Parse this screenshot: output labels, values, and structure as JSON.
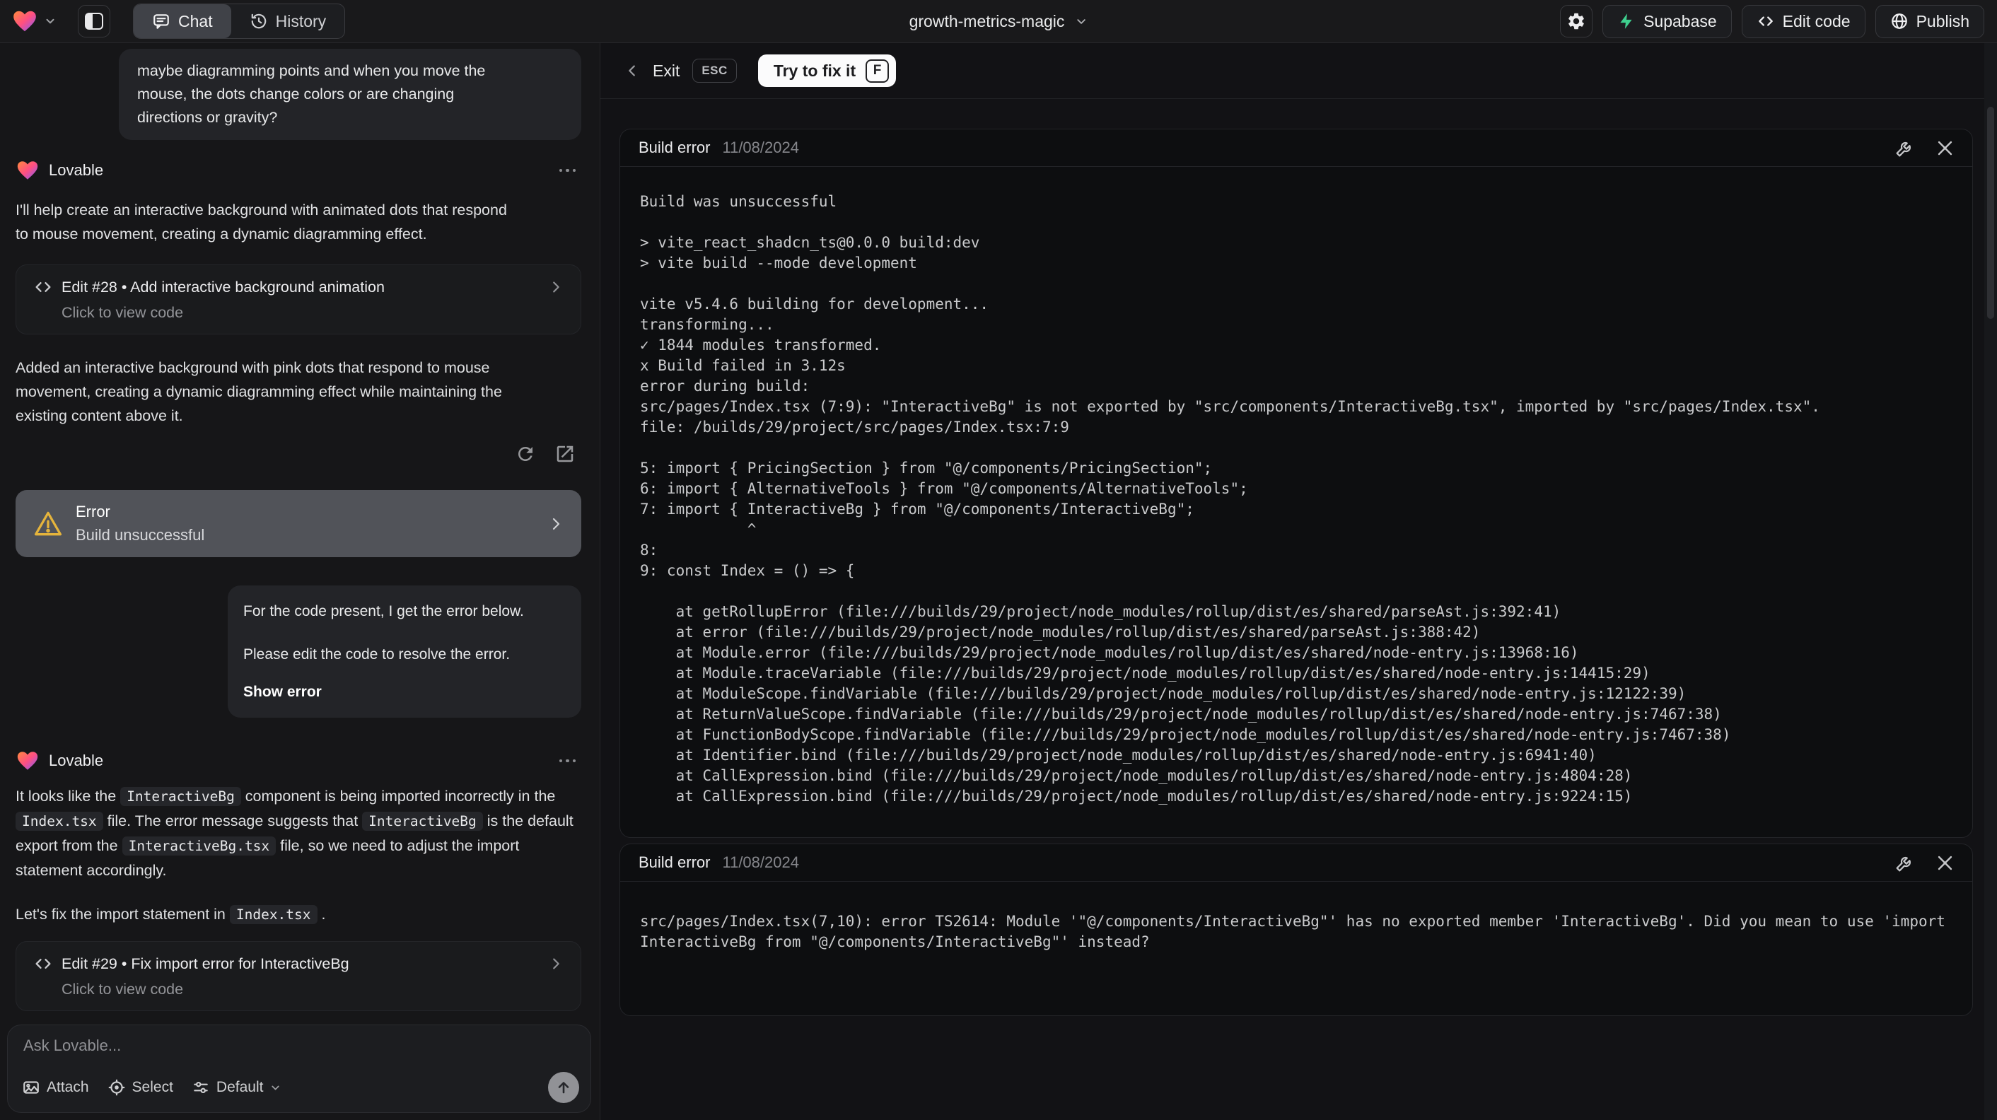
{
  "topbar": {
    "tabs": {
      "chat": "Chat",
      "history": "History"
    },
    "project": {
      "name": "growth-metrics-magic"
    },
    "actions": {
      "supabase": "Supabase",
      "edit_code": "Edit code",
      "publish": "Publish"
    }
  },
  "fix_header": {
    "exit": "Exit",
    "esc_key": "ESC",
    "fix_button": "Try to fix it",
    "fix_key": "F"
  },
  "chat": {
    "user_message_1": "maybe diagramming points and when you move the\nmouse, the dots change colors or are changing\ndirections or gravity?",
    "assistant_name": "Lovable",
    "assistant_1": {
      "p1": "I'll help create an interactive background with animated dots that respond\nto mouse movement, creating a dynamic diagramming effect.",
      "edit_card": {
        "title": "Edit #28 • Add interactive background animation",
        "subtitle": "Click to view code"
      },
      "p2": "Added an interactive background with pink dots that respond to mouse\nmovement, creating a dynamic diagramming effect while maintaining the\nexisting content above it."
    },
    "error_card": {
      "title": "Error",
      "subtitle": "Build unsuccessful"
    },
    "user_message_2": {
      "p1": "For the code present, I get the error below.",
      "p2": "Please edit the code to resolve the error.",
      "link": "Show error"
    },
    "assistant_2": {
      "p1_parts": [
        "It looks like the ",
        "InteractiveBg",
        " component is being imported incorrectly in the ",
        "Index.tsx",
        " file. The error message suggests that ",
        "InteractiveBg",
        " is the default export from the ",
        "InteractiveBg.tsx",
        " file, so we need to adjust the import statement accordingly."
      ],
      "p2_parts": [
        "Let's fix the import statement in ",
        "Index.tsx",
        " ."
      ],
      "edit_card": {
        "title": "Edit #29 • Fix import error for InteractiveBg",
        "subtitle": "Click to view code"
      }
    },
    "input": {
      "placeholder": "Ask Lovable...",
      "attach": "Attach",
      "select": "Select",
      "mode": "Default"
    }
  },
  "error_panels": [
    {
      "title": "Build error",
      "date": "11/08/2024",
      "log": "Build was unsuccessful\n\n> vite_react_shadcn_ts@0.0.0 build:dev\n> vite build --mode development\n\nvite v5.4.6 building for development...\ntransforming...\n✓ 1844 modules transformed.\nx Build failed in 3.12s\nerror during build:\nsrc/pages/Index.tsx (7:9): \"InteractiveBg\" is not exported by \"src/components/InteractiveBg.tsx\", imported by \"src/pages/Index.tsx\".\nfile: /builds/29/project/src/pages/Index.tsx:7:9\n\n5: import { PricingSection } from \"@/components/PricingSection\";\n6: import { AlternativeTools } from \"@/components/AlternativeTools\";\n7: import { InteractiveBg } from \"@/components/InteractiveBg\";\n            ^\n8:\n9: const Index = () => {\n\n    at getRollupError (file:///builds/29/project/node_modules/rollup/dist/es/shared/parseAst.js:392:41)\n    at error (file:///builds/29/project/node_modules/rollup/dist/es/shared/parseAst.js:388:42)\n    at Module.error (file:///builds/29/project/node_modules/rollup/dist/es/shared/node-entry.js:13968:16)\n    at Module.traceVariable (file:///builds/29/project/node_modules/rollup/dist/es/shared/node-entry.js:14415:29)\n    at ModuleScope.findVariable (file:///builds/29/project/node_modules/rollup/dist/es/shared/node-entry.js:12122:39)\n    at ReturnValueScope.findVariable (file:///builds/29/project/node_modules/rollup/dist/es/shared/node-entry.js:7467:38)\n    at FunctionBodyScope.findVariable (file:///builds/29/project/node_modules/rollup/dist/es/shared/node-entry.js:7467:38)\n    at Identifier.bind (file:///builds/29/project/node_modules/rollup/dist/es/shared/node-entry.js:6941:40)\n    at CallExpression.bind (file:///builds/29/project/node_modules/rollup/dist/es/shared/node-entry.js:4804:28)\n    at CallExpression.bind (file:///builds/29/project/node_modules/rollup/dist/es/shared/node-entry.js:9224:15)"
    },
    {
      "title": "Build error",
      "date": "11/08/2024",
      "log": "src/pages/Index.tsx(7,10): error TS2614: Module '\"@/components/InteractiveBg\"' has no exported member 'InteractiveBg'. Did you mean to use 'import\nInteractiveBg from \"@/components/InteractiveBg\"' instead?"
    }
  ],
  "colors": {
    "supabase_green": "#3ecf8e",
    "warning_yellow": "#e5b43c",
    "heart_orange": "#ff8a3d",
    "heart_pink": "#ff4f81",
    "heart_violet": "#7d5cff"
  }
}
